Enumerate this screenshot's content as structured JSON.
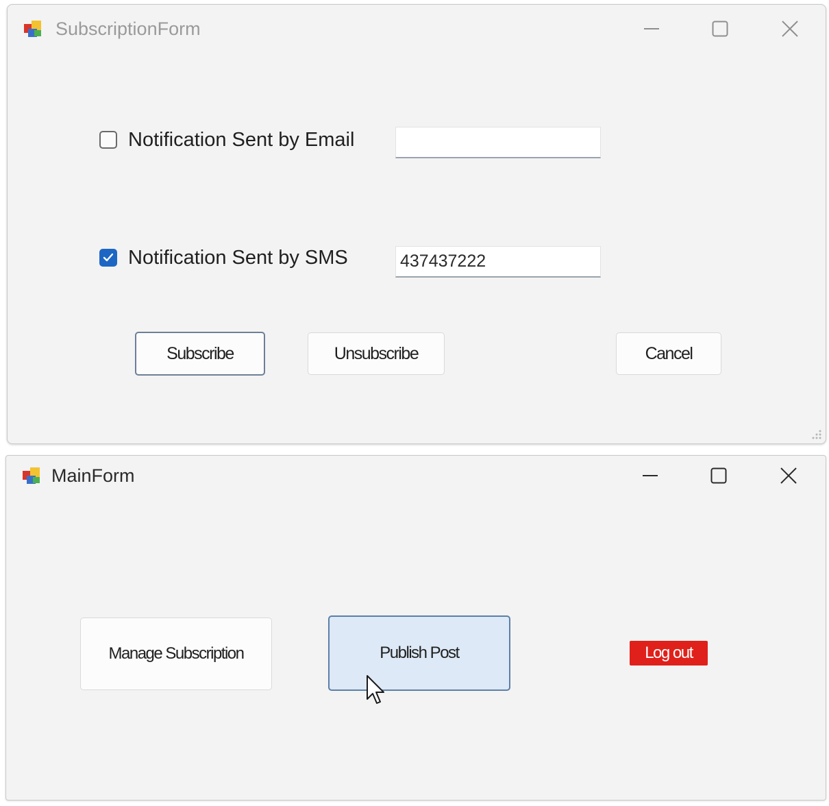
{
  "subscription_form": {
    "title": "SubscriptionForm",
    "email_option": {
      "label": "Notification Sent by Email",
      "checked": false,
      "value": ""
    },
    "sms_option": {
      "label": "Notification Sent by SMS",
      "checked": true,
      "value": "437437222"
    },
    "buttons": {
      "subscribe": "Subscribe",
      "unsubscribe": "Unsubscribe",
      "cancel": "Cancel"
    }
  },
  "main_form": {
    "title": "MainForm",
    "buttons": {
      "manage_subscription": "Manage Subscription",
      "publish_post": "Publish Post",
      "log_out": "Log out"
    }
  },
  "icons": {
    "app_icon": "app-icon",
    "minimize": "minimize-icon",
    "maximize": "maximize-icon",
    "close": "close-icon",
    "checkmark": "checkmark-icon",
    "cursor": "mouse-pointer-icon"
  },
  "colors": {
    "window_bg": "#f3f3f3",
    "checkbox_checked": "#1e66c4",
    "logout_bg": "#e0201a",
    "pressed_button_bg": "#dde9f6"
  }
}
